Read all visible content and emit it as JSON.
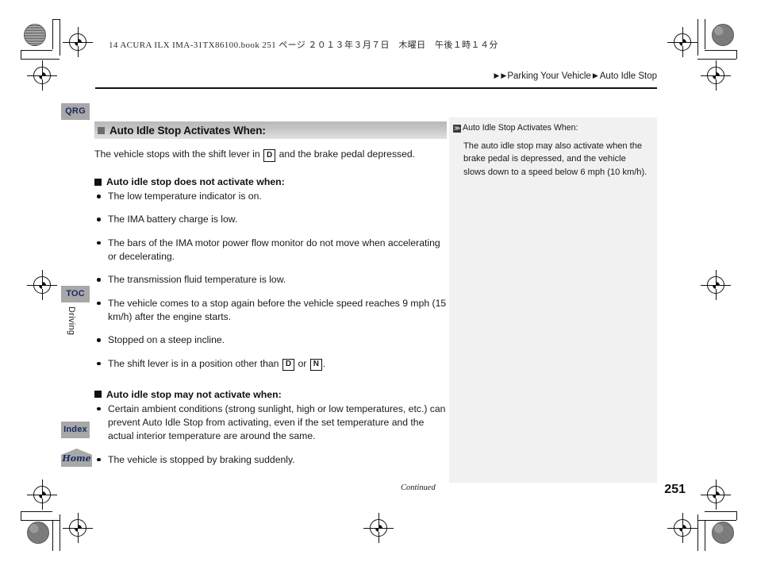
{
  "print": {
    "jp_header": "14 ACURA ILX IMA-31TX86100.book  251 ページ  ２０１３年３月７日　木曜日　午後１時１４分"
  },
  "breadcrumb": {
    "marker1": "▶",
    "marker2": "▶",
    "section": "Parking Your Vehicle",
    "separator": "▶",
    "topic": "Auto Idle Stop"
  },
  "tabs": {
    "qrg": "QRG",
    "toc": "TOC",
    "index": "Index",
    "home": "Home",
    "chapter": "Driving"
  },
  "main": {
    "section_heading": "Auto Idle Stop Activates When:",
    "intro_before": "The vehicle stops with the shift lever in",
    "intro_gear": "D",
    "intro_after": "and the brake pedal depressed.",
    "group_does_not": {
      "heading": "Auto idle stop does not activate when:",
      "items": [
        "The low temperature indicator is on.",
        "The IMA battery charge is low.",
        "The bars of the IMA motor power flow monitor do not move when accelerating or decelerating.",
        "The transmission fluid temperature is low.",
        "The vehicle comes to a stop again before the vehicle speed reaches 9 mph (15 km/h) after the engine starts.",
        "Stopped on a steep incline."
      ],
      "last_item_before": "The shift lever is in a position other than",
      "last_item_gear1": "D",
      "last_item_middle": "or",
      "last_item_gear2": "N",
      "last_item_after": "."
    },
    "group_may_not": {
      "heading": "Auto idle stop may not activate when:",
      "items": [
        "Certain ambient conditions (strong sunlight, high or low temperatures, etc.) can prevent Auto Idle Stop from activating, even if the set temperature and the actual interior temperature are around the same.",
        "The vehicle is stopped by braking suddenly."
      ]
    }
  },
  "sidenote": {
    "marker": "≫",
    "title": "Auto Idle Stop Activates When:",
    "body": "The auto idle stop may also activate when the brake pedal is depressed, and the vehicle slows down to a speed below 6 mph (10 km/h)."
  },
  "footer": {
    "continued": "Continued",
    "page_number": "251"
  },
  "colors": {
    "tab_background": "#a8a8a8",
    "tab_text": "#1b2a63",
    "sidenote_background": "#f1f1f1",
    "section_heading_bar": "#c4c4c4"
  }
}
